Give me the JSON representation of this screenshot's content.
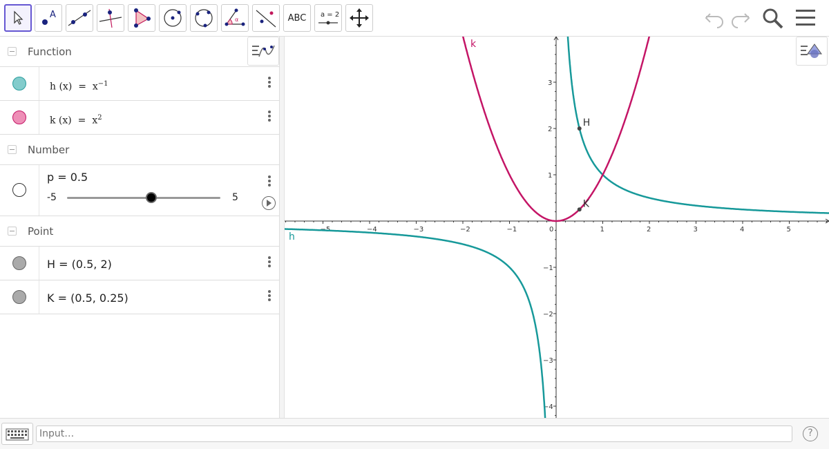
{
  "toolbar": {
    "tools": [
      {
        "name": "move-tool",
        "active": true
      },
      {
        "name": "point-tool"
      },
      {
        "name": "line-tool"
      },
      {
        "name": "perpendicular-line-tool"
      },
      {
        "name": "polygon-tool"
      },
      {
        "name": "circle-center-point-tool"
      },
      {
        "name": "circle-three-points-tool"
      },
      {
        "name": "angle-tool"
      },
      {
        "name": "reflect-tool"
      },
      {
        "name": "text-tool",
        "label": "ABC"
      },
      {
        "name": "slider-tool",
        "label": "a = 2"
      },
      {
        "name": "move-graphics-tool"
      }
    ],
    "right_icons": [
      "undo-icon",
      "redo-icon",
      "search-icon",
      "menu-icon"
    ]
  },
  "algebra": {
    "groups": {
      "function": "Function",
      "number": "Number",
      "point": "Point"
    },
    "functions": [
      {
        "name": "h",
        "lhs": "h (x)",
        "eq": "=",
        "base": "x",
        "exp": "−1",
        "color": "#2a9d9d"
      },
      {
        "name": "k",
        "lhs": "k (x)",
        "eq": "=",
        "base": "x",
        "exp": "2",
        "color": "#e0669b"
      }
    ],
    "slider": {
      "text": "p = 0.5",
      "min": "-5",
      "max": "5",
      "value": 0.5
    },
    "points": [
      {
        "text": "H = (0.5, 2)",
        "color": "#888888"
      },
      {
        "text": "K = (0.5, 0.25)",
        "color": "#888888"
      }
    ]
  },
  "graphics": {
    "x_ticks": [
      "−5",
      "−4",
      "−3",
      "−2",
      "−1",
      "0",
      "1",
      "2",
      "3",
      "4",
      "5"
    ],
    "y_ticks": [
      "−4",
      "−3",
      "−2",
      "−1",
      "1",
      "2",
      "3"
    ],
    "curve_labels": {
      "h": "h",
      "k": "k"
    },
    "point_labels": {
      "H": "H",
      "K": "K"
    },
    "colors": {
      "h": "#17999a",
      "k": "#c41566",
      "axis": "#333333"
    }
  },
  "chart_data": {
    "type": "line",
    "series": [
      {
        "name": "h",
        "formula": "x^-1"
      },
      {
        "name": "k",
        "formula": "x^2"
      }
    ],
    "points": [
      {
        "name": "H",
        "x": 0.5,
        "y": 2
      },
      {
        "name": "K",
        "x": 0.5,
        "y": 0.25
      }
    ],
    "xlim": [
      -5.8,
      5.8
    ],
    "ylim": [
      -4.2,
      3.9
    ],
    "grid": false
  },
  "input_bar": {
    "placeholder": "Input…",
    "help": "?"
  }
}
